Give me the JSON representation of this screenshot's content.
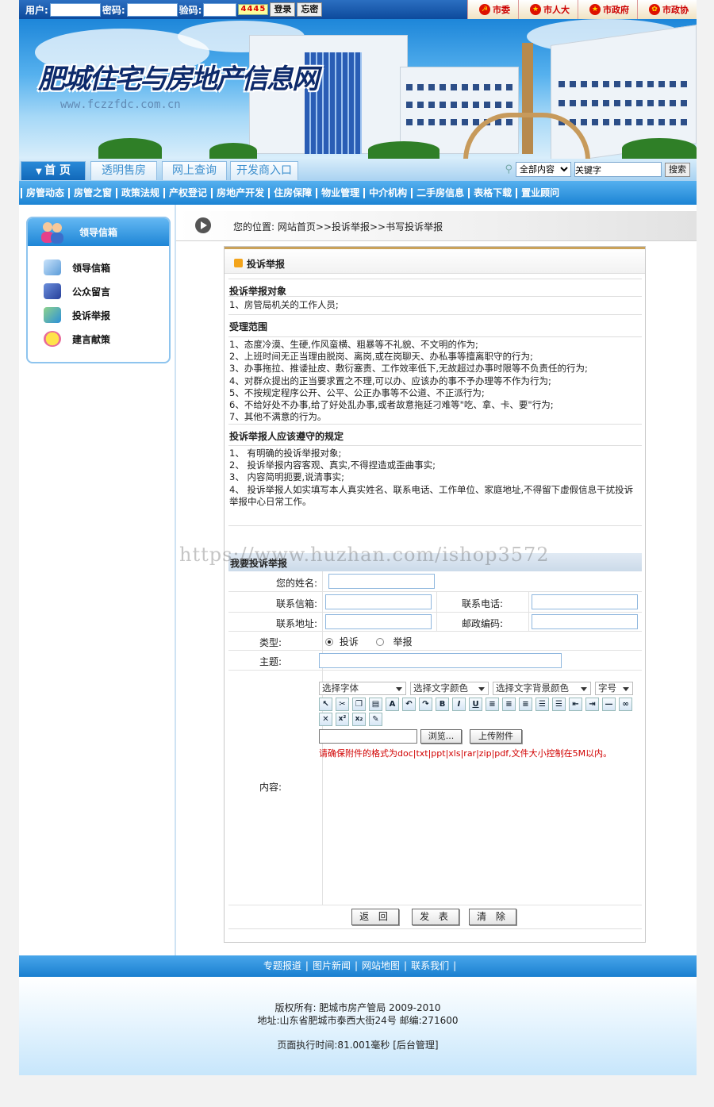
{
  "login": {
    "user_label": "用户:",
    "pass_label": "密码:",
    "code_label": "验码:",
    "captcha": "4445",
    "login_btn": "登录",
    "forgot_btn": "忘密"
  },
  "gov_links": [
    "市委",
    "市人大",
    "市政府",
    "市政协"
  ],
  "banner": {
    "title": "肥城住宅与房地产信息网",
    "url": "www.fczzfdc.com.cn"
  },
  "tabs": [
    "首 页",
    "透明售房",
    "网上查询",
    "开发商入口"
  ],
  "search": {
    "scope": "全部内容",
    "placeholder": "关键字",
    "button": "搜索"
  },
  "categories": [
    "房管动态",
    "房管之窗",
    "政策法规",
    "产权登记",
    "房地产开发",
    "住房保障",
    "物业管理",
    "中介机构",
    "二手房信息",
    "表格下载",
    "置业顾问",
    ""
  ],
  "sidebar": {
    "title": "领导信箱",
    "items": [
      {
        "label": "领导信箱"
      },
      {
        "label": "公众留言"
      },
      {
        "label": "投诉举报"
      },
      {
        "label": "建言献策"
      }
    ]
  },
  "breadcrumb": "您的位置:  网站首页>>投诉举报>>书写投诉举报",
  "panel": {
    "title": "投诉举报",
    "sections": [
      {
        "heading": "投诉举报对象",
        "lines": [
          "1、房管局机关的工作人员;"
        ]
      },
      {
        "heading": "受理范围",
        "lines": [
          "1、态度冷漠、生硬,作风蛮横、粗暴等不礼貌、不文明的作为;",
          "2、上班时间无正当理由脱岗、离岗,或在岗聊天、办私事等擅离职守的行为;",
          "3、办事拖拉、推诿扯皮、敷衍塞责、工作效率低下,无故超过办事时限等不负责任的行为;",
          "4、对群众提出的正当要求置之不理,可以办、应该办的事不予办理等不作为行为;",
          "5、不按规定程序公开、公平、公正办事等不公道、不正派行为;",
          "6、不给好处不办事,给了好处乱办事,或者故意拖延刁难等\"吃、拿、卡、要\"行为;",
          "7、其他不满意的行为。"
        ]
      },
      {
        "heading": "投诉举报人应该遵守的规定",
        "lines": [
          "1、  有明确的投诉举报对象;",
          "2、  投诉举报内容客观、真实,不得捏造或歪曲事实;",
          "3、  内容简明扼要,说清事实;",
          "4、  投诉举报人如实填写本人真实姓名、联系电话、工作单位、家庭地址,不得留下虚假信息干扰投诉举报中心日常工作。"
        ]
      }
    ],
    "form": {
      "heading": "我要投诉举报",
      "name_label": "您的姓名:",
      "email_label": "联系信箱:",
      "phone_label": "联系电话:",
      "address_label": "联系地址:",
      "zip_label": "邮政编码:",
      "type_label": "类型:",
      "type_options": [
        "投诉",
        "举报"
      ],
      "subject_label": "主题:",
      "content_label": "内容:",
      "toolbar": {
        "font": "选择字体",
        "color": "选择文字颜色",
        "bgcolor": "选择文字背景颜色",
        "size": "字号"
      },
      "icon_buttons": [
        "B",
        "I",
        "U"
      ],
      "browse_btn": "浏览...",
      "upload_btn": "上传附件",
      "attach_note": "请确保附件的格式为doc|txt|ppt|xls|rar|zip|pdf,文件大小控制在5M以内。",
      "buttons": [
        "返 回",
        "发 表",
        "清 除"
      ]
    }
  },
  "watermark": "https://www.huzhan.com/ishop3572",
  "footer": {
    "links": [
      "专题报道",
      "图片新闻",
      "网站地图",
      "联系我们"
    ],
    "copyright": "版权所有:  肥城市房产管局  2009-2010",
    "address": "地址:山东省肥城市泰西大街24号  邮编:271600",
    "exec": "页面执行时间:81.001毫秒  [后台管理]"
  },
  "colors": {
    "nav_blue": "#1c84d4",
    "accent_red": "#d10000",
    "gold": "#caa25a"
  }
}
